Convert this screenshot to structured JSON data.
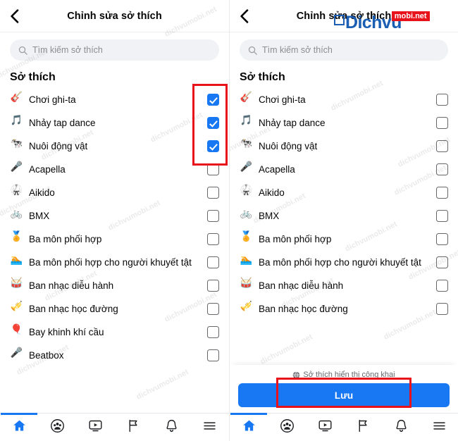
{
  "header": {
    "title": "Chỉnh sửa sở thích",
    "back_icon": "chevron-left-icon"
  },
  "search": {
    "placeholder": "Tìm kiếm sở thích",
    "value": "",
    "icon": "search-icon"
  },
  "section": {
    "title": "Sở thích"
  },
  "interests_left": [
    {
      "emoji": "🎸",
      "label": "Chơi ghi-ta",
      "checked": true
    },
    {
      "emoji": "🎵",
      "label": "Nhảy tap dance",
      "checked": true
    },
    {
      "emoji": "🐄",
      "label": "Nuôi động vật",
      "checked": true
    },
    {
      "emoji": "🎤",
      "label": "Acapella",
      "checked": false
    },
    {
      "emoji": "🥋",
      "label": "Aikido",
      "checked": false
    },
    {
      "emoji": "🚲",
      "label": "BMX",
      "checked": false
    },
    {
      "emoji": "🏅",
      "label": "Ba môn phối hợp",
      "checked": false
    },
    {
      "emoji": "🏊",
      "label": "Ba môn phối hợp cho người khuyết tật",
      "checked": false
    },
    {
      "emoji": "🥁",
      "label": "Ban nhạc diễu hành",
      "checked": false
    },
    {
      "emoji": "🎺",
      "label": "Ban nhạc học đường",
      "checked": false
    },
    {
      "emoji": "🎈",
      "label": "Bay khinh khí cầu",
      "checked": false
    },
    {
      "emoji": "🎤",
      "label": "Beatbox",
      "checked": false
    }
  ],
  "interests_right": [
    {
      "emoji": "🎸",
      "label": "Chơi ghi-ta",
      "checked": false
    },
    {
      "emoji": "🎵",
      "label": "Nhảy tap dance",
      "checked": false
    },
    {
      "emoji": "🐄",
      "label": "Nuôi động vật",
      "checked": false
    },
    {
      "emoji": "🎤",
      "label": "Acapella",
      "checked": false
    },
    {
      "emoji": "🥋",
      "label": "Aikido",
      "checked": false
    },
    {
      "emoji": "🚲",
      "label": "BMX",
      "checked": false
    },
    {
      "emoji": "🏅",
      "label": "Ba môn phối hợp",
      "checked": false
    },
    {
      "emoji": "🏊",
      "label": "Ba môn phối hợp cho người khuyết tật",
      "checked": false
    },
    {
      "emoji": "🥁",
      "label": "Ban nhạc diễu hành",
      "checked": false
    },
    {
      "emoji": "🎺",
      "label": "Ban nhạc học đường",
      "checked": false
    }
  ],
  "footer": {
    "privacy_text": "Sở thích hiển thị công khai",
    "privacy_icon": "globe-icon",
    "save_label": "Lưu"
  },
  "bottom_nav": [
    {
      "name": "home",
      "icon": "home-icon",
      "active": true
    },
    {
      "name": "friends",
      "icon": "friends-icon",
      "active": false
    },
    {
      "name": "watch",
      "icon": "video-play-icon",
      "active": false
    },
    {
      "name": "marketplace",
      "icon": "flag-icon",
      "active": false
    },
    {
      "name": "notifications",
      "icon": "bell-icon",
      "active": false
    },
    {
      "name": "menu",
      "icon": "hamburger-menu-icon",
      "active": false
    }
  ],
  "watermark": {
    "text": "dichvumobi.net",
    "logo_primary": "Dichvu",
    "logo_badge": "mobi.net"
  },
  "colors": {
    "accent": "#1877f2",
    "highlight": "#e8131a",
    "text": "#050505",
    "muted": "#65676b",
    "field_bg": "#f0f2f5"
  }
}
